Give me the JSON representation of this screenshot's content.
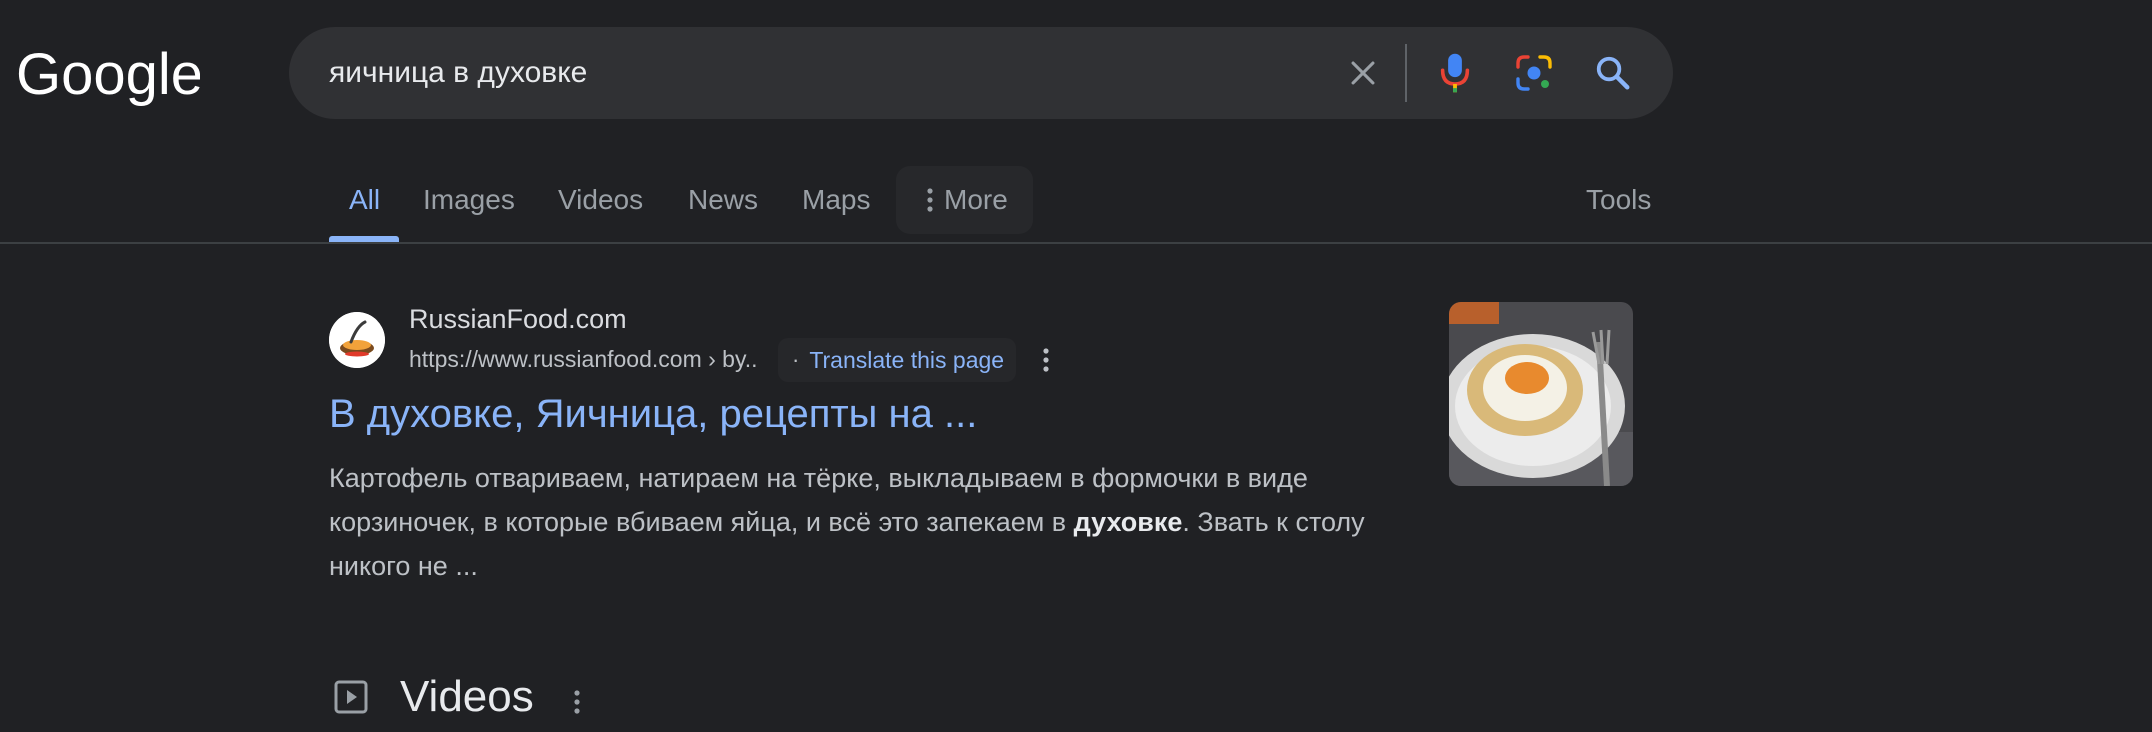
{
  "header": {
    "logo_text": "Google",
    "search": {
      "query": "яичница в духовке",
      "clear_icon": "close-icon",
      "voice_icon": "mic-icon",
      "lens_icon": "lens-icon",
      "submit_icon": "search-icon"
    }
  },
  "tabs": {
    "items": [
      {
        "label": "All",
        "active": true
      },
      {
        "label": "Images",
        "active": false
      },
      {
        "label": "Videos",
        "active": false
      },
      {
        "label": "News",
        "active": false
      },
      {
        "label": "Maps",
        "active": false
      },
      {
        "label": "More",
        "active": false
      }
    ],
    "tools_label": "Tools"
  },
  "results": [
    {
      "site_name": "RussianFood.com",
      "url": "https://www.russianfood.com › by..",
      "translate_label": "Translate this page",
      "title": "В духовке, Яичница, рецепты на ...",
      "snippet_parts": [
        "Картофель отвариваем, натираем на тёрке, выкладываем в формочки в виде корзиночек, в которые вбиваем яйца, и всё это запекаем в ",
        "духовке",
        ". Звать к столу никого не ..."
      ]
    }
  ],
  "videos_section": {
    "title": "Videos",
    "icon": "play-box-icon"
  },
  "colors": {
    "background": "#202124",
    "searchbar": "#303134",
    "link": "#8ab4f8",
    "text": "#bdc1c6"
  }
}
